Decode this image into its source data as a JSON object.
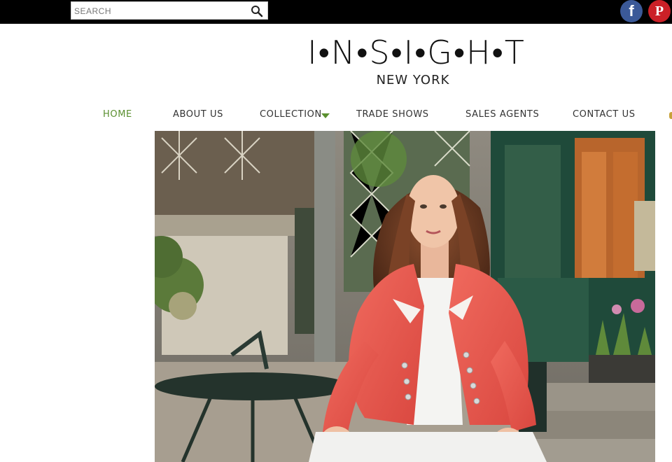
{
  "search": {
    "placeholder": "SEARCH"
  },
  "social": {
    "facebook_glyph": "f",
    "pinterest_glyph": "P",
    "facebook_color": "#3b5998",
    "pinterest_color": "#cb2027"
  },
  "logo": {
    "main": "I•N•S•I•G•H•T",
    "sub": "NEW YORK"
  },
  "nav": {
    "items": [
      {
        "label": "HOME",
        "active": true
      },
      {
        "label": "ABOUT US"
      },
      {
        "label": "COLLECTION",
        "has_dropdown": true
      },
      {
        "label": "TRADE SHOWS"
      },
      {
        "label": "SALES AGENTS"
      },
      {
        "label": "CONTACT US"
      }
    ],
    "accent_color": "#5a8f2f"
  },
  "icons": {
    "search": "search-icon",
    "dropdown": "caret-down-icon",
    "facebook": "facebook-icon",
    "pinterest": "pinterest-icon"
  }
}
